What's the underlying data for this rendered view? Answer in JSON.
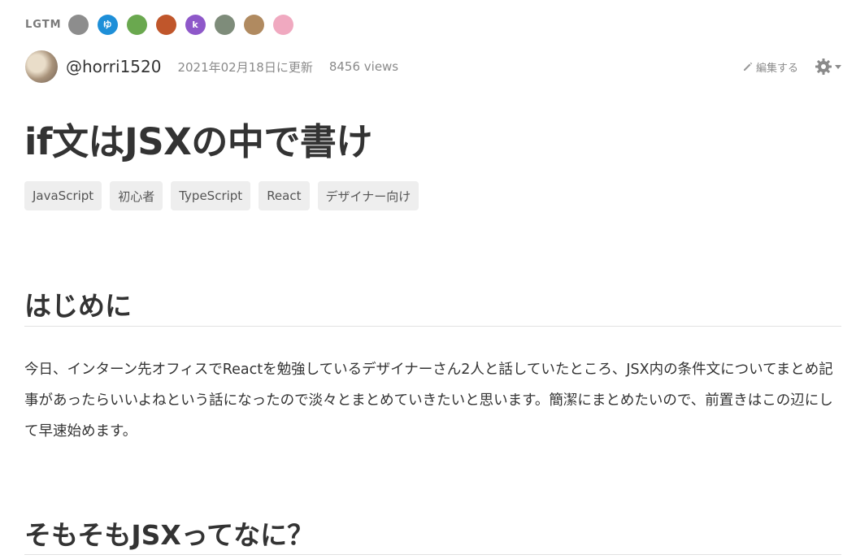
{
  "lgtm": {
    "label": "LGTM",
    "avatars": [
      {
        "name": "avatar-1",
        "color": "#8d8d8d",
        "glyph": ""
      },
      {
        "name": "avatar-2",
        "color": "#1e8fd8",
        "glyph": "ゆ"
      },
      {
        "name": "avatar-3",
        "color": "#6aa84f",
        "glyph": ""
      },
      {
        "name": "avatar-4",
        "color": "#c0562b",
        "glyph": ""
      },
      {
        "name": "avatar-5",
        "color": "#8e58c9",
        "glyph": "k"
      },
      {
        "name": "avatar-6",
        "color": "#7e8c7a",
        "glyph": ""
      },
      {
        "name": "avatar-7",
        "color": "#b08a60",
        "glyph": ""
      },
      {
        "name": "avatar-8",
        "color": "#f0a9c0",
        "glyph": ""
      }
    ]
  },
  "author": {
    "username": "@horri1520",
    "updated": "2021年02月18日に更新",
    "views": "8456 views"
  },
  "tools": {
    "edit_label": "編集する",
    "edit_icon": "pencil-icon",
    "settings_icon": "gear-icon"
  },
  "article": {
    "title": "if文はJSXの中で書け",
    "tags": [
      "JavaScript",
      "初心者",
      "TypeScript",
      "React",
      "デザイナー向け"
    ],
    "section1_heading": "はじめに",
    "paragraph1": "今日、インターン先オフィスでReactを勉強しているデザイナーさん2人と話していたところ、JSX内の条件文についてまとめ記事があったらいいよねという話になったので淡々とまとめていきたいと思います。簡潔にまとめたいので、前置きはこの辺にして早速始めます。",
    "section2_heading": "そもそもJSXってなに？"
  }
}
